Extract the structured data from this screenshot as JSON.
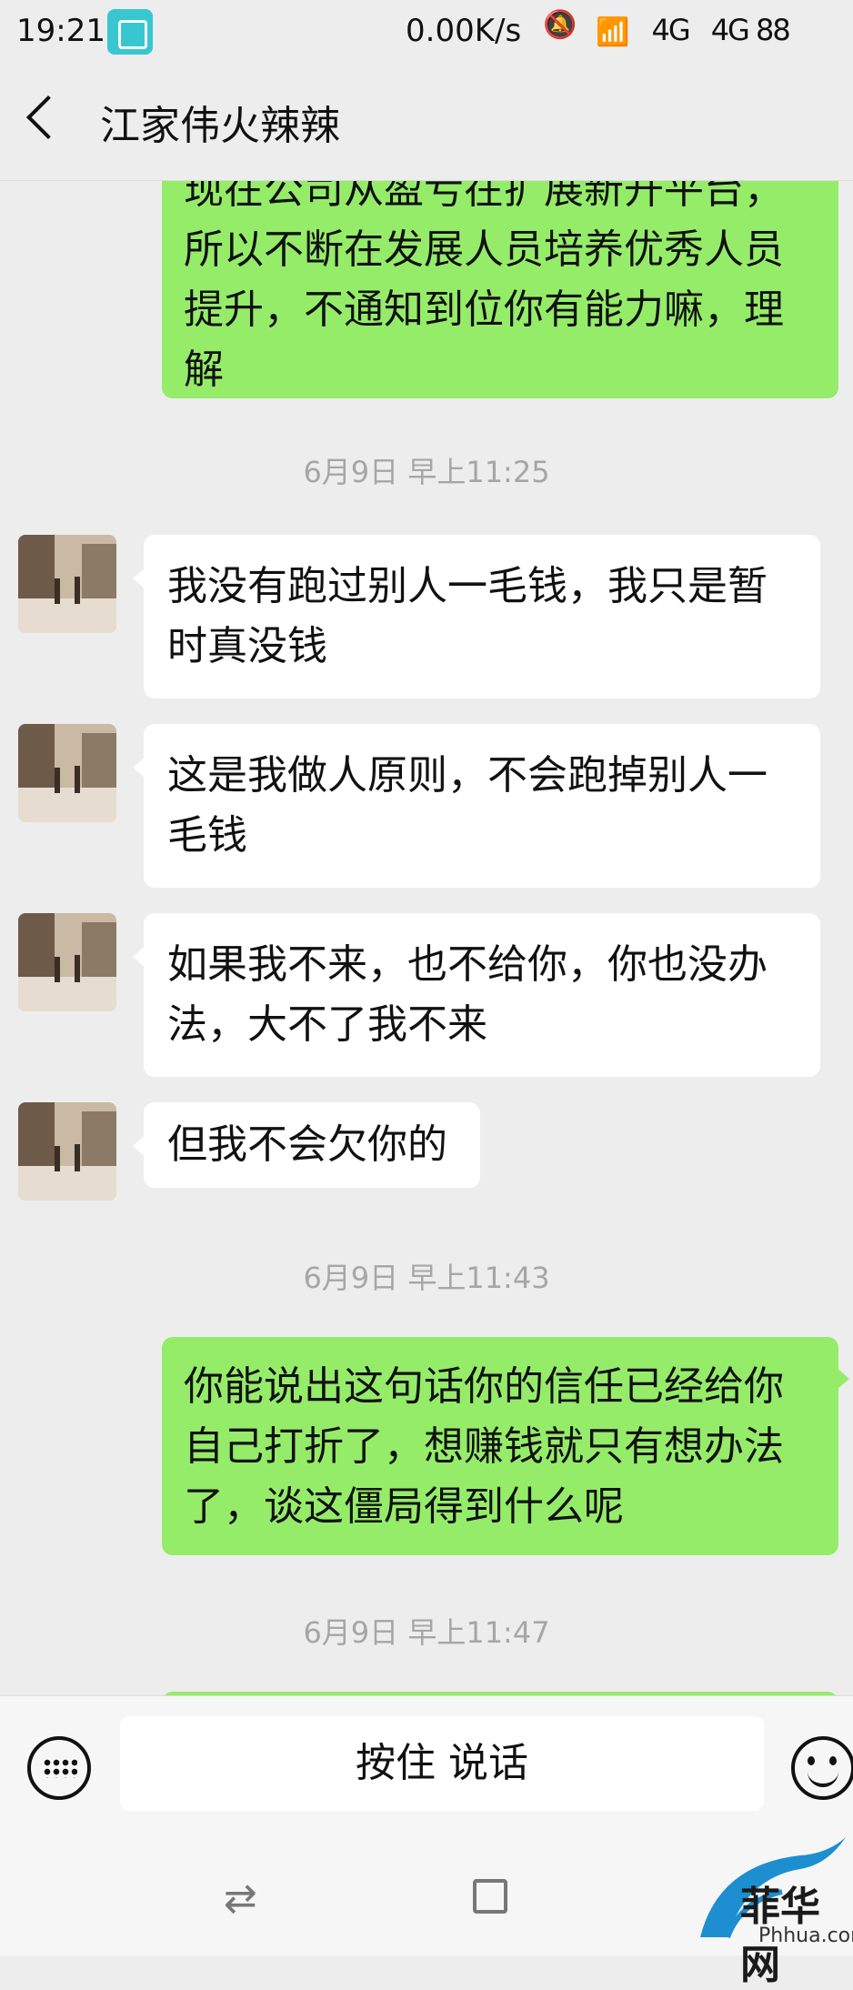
{
  "status_bar": {
    "time": "19:21",
    "net_speed": "0.00K/s",
    "sig1": "4G",
    "sig2": "4G 88"
  },
  "header": {
    "title": "江家伟火辣辣"
  },
  "messages": {
    "m0": {
      "lines": [
        "现在公司从盈亏在扩展新开平台，",
        "所以不断在发展人员培养优秀人员",
        "提升，不通知到位你有能力嘛，理",
        "解"
      ]
    },
    "ts1": "6月9日 早上11:25",
    "m1": {
      "lines": [
        "我没有跑过别人一毛钱，我只是暂",
        "时真没钱"
      ]
    },
    "m2": {
      "lines": [
        "这是我做人原则，不会跑掉别人一",
        "毛钱"
      ]
    },
    "m3": {
      "lines": [
        "如果我不来，也不给你，你也没办",
        "法，大不了我不来"
      ]
    },
    "m4": {
      "lines": [
        "但我不会欠你的"
      ]
    },
    "ts2": "6月9日 早上11:43",
    "m5": {
      "lines": [
        "你能说出这句话你的信任已经给你",
        "自己打折了，想赚钱就只有想办法",
        "了，谈这僵局得到什么呢"
      ]
    },
    "ts3": "6月9日 早上11:47"
  },
  "input_bar": {
    "hold_to_talk": "按住 说话"
  },
  "nav": {
    "switch_glyph": "⇄"
  },
  "watermark": {
    "text": "菲华网",
    "url": "Phhua.com"
  },
  "colors": {
    "sent_bubble": "#95ec69",
    "received_bubble": "#ffffff",
    "background": "#ededed"
  }
}
